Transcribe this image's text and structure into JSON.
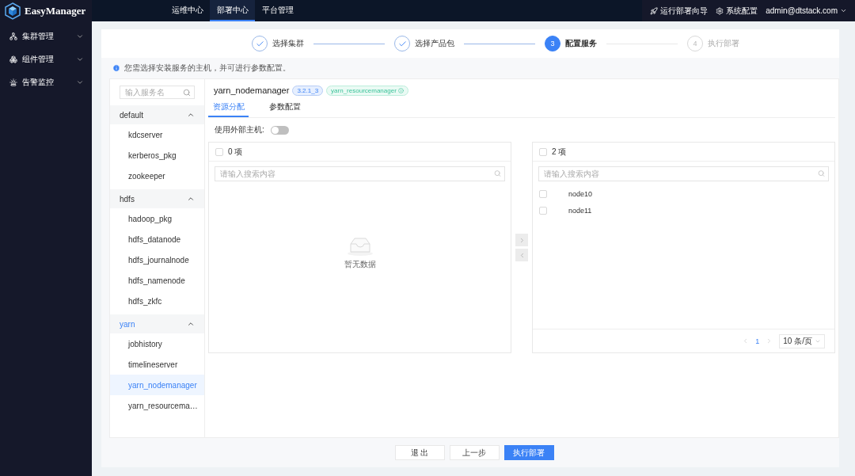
{
  "app": {
    "name": "EasyManager"
  },
  "top_nav": [
    {
      "label": "运维中心",
      "selected": false
    },
    {
      "label": "部署中心",
      "selected": true
    },
    {
      "label": "平台管理",
      "selected": false
    }
  ],
  "top_actions": [
    {
      "kind": "guide",
      "label": "运行部署向导"
    },
    {
      "kind": "settings",
      "label": "系统配置"
    },
    {
      "kind": "user",
      "label": "admin@dtstack.com"
    }
  ],
  "sidebar": {
    "items": [
      {
        "kind": "cluster",
        "label": "集群管理"
      },
      {
        "kind": "component",
        "label": "组件管理"
      },
      {
        "kind": "alert",
        "label": "告警监控"
      }
    ]
  },
  "steps": [
    {
      "label": "选择集群",
      "done": true,
      "active": false
    },
    {
      "label": "选择产品包",
      "done": true,
      "active": false
    },
    {
      "number": "3",
      "label": "配置服务",
      "done": false,
      "active": true
    },
    {
      "number": "4",
      "label": "执行部署",
      "done": false,
      "active": false
    }
  ],
  "notice": "您需选择安装服务的主机，并可进行参数配置。",
  "service_list": {
    "placeholder": "输入服务名",
    "groups": [
      {
        "name": "default",
        "expanded": true,
        "selected": false,
        "children": [
          {
            "name": "kdcserver",
            "selected": false
          },
          {
            "name": "kerberos_pkg",
            "selected": false
          },
          {
            "name": "zookeeper",
            "selected": false
          }
        ]
      },
      {
        "name": "hdfs",
        "expanded": true,
        "selected": false,
        "children": [
          {
            "name": "hadoop_pkg",
            "selected": false
          },
          {
            "name": "hdfs_datanode",
            "selected": false
          },
          {
            "name": "hdfs_journalnode",
            "selected": false
          },
          {
            "name": "hdfs_namenode",
            "selected": false
          },
          {
            "name": "hdfs_zkfc",
            "selected": false
          }
        ]
      },
      {
        "name": "yarn",
        "expanded": true,
        "selected": true,
        "children": [
          {
            "name": "jobhistory",
            "selected": false
          },
          {
            "name": "timelineserver",
            "selected": false
          },
          {
            "name": "yarn_nodemanager",
            "selected": true
          },
          {
            "name": "yarn_resourcema…",
            "selected": false
          }
        ]
      }
    ]
  },
  "service": {
    "name": "yarn_nodemanager",
    "version": "3.2.1_3",
    "dependency": "yarn_resourcemanager"
  },
  "tabs": [
    {
      "label": "资源分配",
      "selected": true
    },
    {
      "label": "参数配置",
      "selected": false
    }
  ],
  "external_host": {
    "label": "使用外部主机:",
    "on": false
  },
  "transfer": {
    "source": {
      "count": "0 项",
      "checked": false,
      "placeholder": "请输入搜索内容",
      "empty_text": "暂无数据"
    },
    "target": {
      "count": "2 项",
      "checked": false,
      "placeholder": "请输入搜索内容",
      "items": [
        {
          "name": "node10",
          "checked": false
        },
        {
          "name": "node11",
          "checked": false
        }
      ],
      "pagination": {
        "page": "1",
        "page_size": "10 条/页"
      }
    }
  },
  "buttons": [
    {
      "label": "退 出",
      "kind": "default"
    },
    {
      "label": "上一步",
      "kind": "default"
    },
    {
      "label": "执行部署",
      "kind": "primary"
    }
  ]
}
